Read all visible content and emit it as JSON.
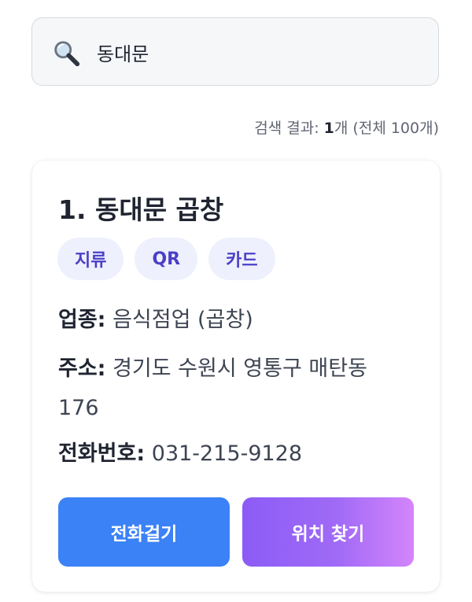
{
  "search": {
    "value": "동대문",
    "placeholder": ""
  },
  "results": {
    "prefix": "검색 결과: ",
    "count": "1",
    "suffix": "개 (전체 100개)"
  },
  "card": {
    "title": "1. 동대문 곱창",
    "tags": [
      "지류",
      "QR",
      "카드"
    ],
    "category_label": "업종:",
    "category_value": "음식점업 (곱창)",
    "address_label": "주소:",
    "address_value": "경기도 수원시 영통구 매탄동 176",
    "phone_label": "전화번호:",
    "phone_value": "031-215-9128",
    "call_button": "전화걸기",
    "map_button": "위치 찾기"
  },
  "icons": {
    "search": "search-icon"
  },
  "colors": {
    "call_button": "#3b82f6",
    "map_button_start": "#8b5cf6",
    "map_button_end": "#d485fb",
    "tag_bg": "#eef0fd",
    "tag_text": "#4a3fc7"
  }
}
